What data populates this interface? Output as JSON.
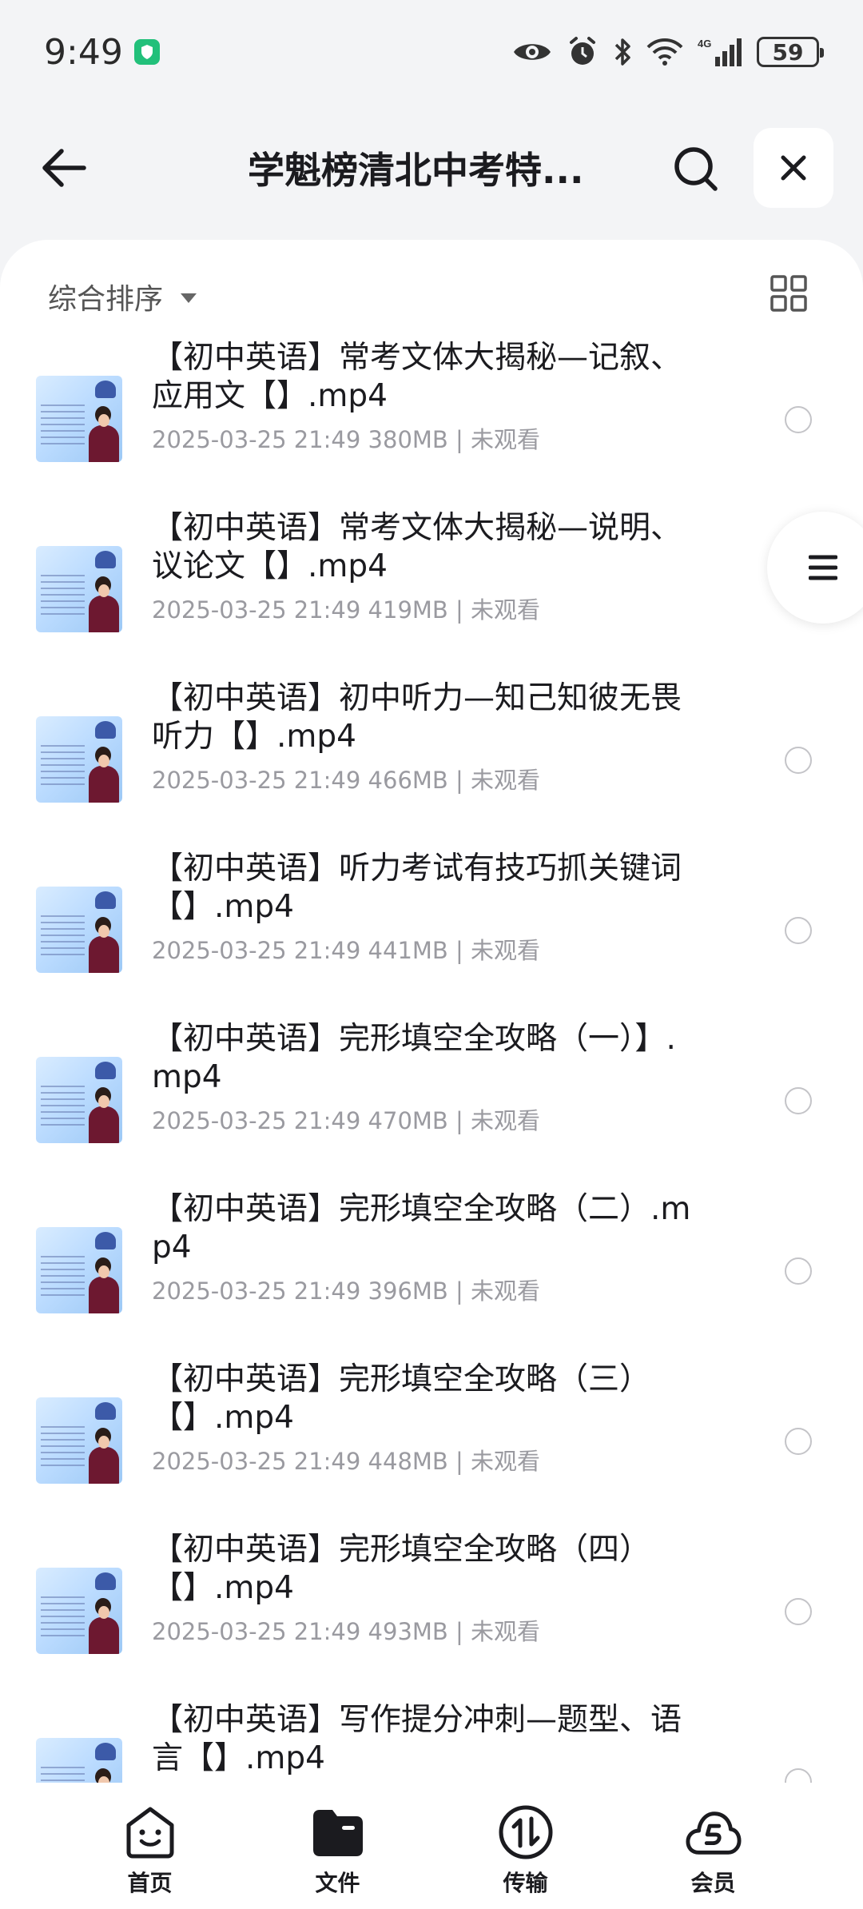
{
  "status_bar": {
    "time": "9:49",
    "battery": "59",
    "network": "4G"
  },
  "header": {
    "title": "学魁榜清北中考特...",
    "back_icon": "arrow-left-icon",
    "search_icon": "search-icon",
    "close_icon": "close-icon"
  },
  "toolbar": {
    "sort_label": "综合排序",
    "view_toggle_icon": "grid-view-icon"
  },
  "files": [
    {
      "name": "【初中英语】常考文体大揭秘—记叙、应用文【】.mp4",
      "date": "2025-03-25 21:49",
      "size": "380MB",
      "status": "未观看"
    },
    {
      "name": "【初中英语】常考文体大揭秘—说明、议论文【】.mp4",
      "date": "2025-03-25 21:49",
      "size": "419MB",
      "status": "未观看"
    },
    {
      "name": "【初中英语】初中听力—知己知彼无畏听力【】.mp4",
      "date": "2025-03-25 21:49",
      "size": "466MB",
      "status": "未观看"
    },
    {
      "name": "【初中英语】听力考试有技巧抓关键词【】.mp4",
      "date": "2025-03-25 21:49",
      "size": "441MB",
      "status": "未观看"
    },
    {
      "name": "【初中英语】完形填空全攻略（一）】.mp4",
      "date": "2025-03-25 21:49",
      "size": "470MB",
      "status": "未观看"
    },
    {
      "name": "【初中英语】完形填空全攻略（二）.mp4",
      "date": "2025-03-25 21:49",
      "size": "396MB",
      "status": "未观看"
    },
    {
      "name": "【初中英语】完形填空全攻略（三）【】.mp4",
      "date": "2025-03-25 21:49",
      "size": "448MB",
      "status": "未观看"
    },
    {
      "name": "【初中英语】完形填空全攻略（四）【】.mp4",
      "date": "2025-03-25 21:49",
      "size": "493MB",
      "status": "未观看"
    },
    {
      "name": "【初中英语】写作提分冲刺—题型、语言【】.mp4",
      "date": "",
      "size": "",
      "status": ""
    }
  ],
  "bottom_nav": [
    {
      "label": "首页",
      "icon": "home-face-icon"
    },
    {
      "label": "文件",
      "icon": "folder-icon"
    },
    {
      "label": "传输",
      "icon": "transfer-icon"
    },
    {
      "label": "会员",
      "icon": "member-cloud-icon"
    }
  ],
  "colors": {
    "background": "#f3f4f6",
    "panel": "#ffffff",
    "text_primary": "#1b1b1f",
    "text_secondary": "#9a9aa0",
    "shield_green": "#22c07a"
  }
}
